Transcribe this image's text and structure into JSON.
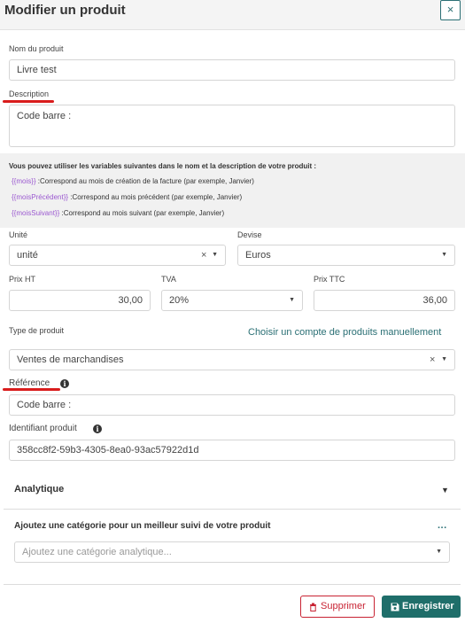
{
  "header": {
    "title": "Modifier un produit",
    "close": "×"
  },
  "fields": {
    "nom_label": "Nom du produit",
    "nom_value": "Livre test",
    "description_label": "Description",
    "description_value": "Code barre :",
    "unite_label": "Unité",
    "unite_value": "unité",
    "devise_label": "Devise",
    "devise_value": "Euros",
    "prix_ht_label": "Prix HT",
    "prix_ht_value": "30,00",
    "tva_label": "TVA",
    "tva_value": "20%",
    "prix_ttc_label": "Prix TTC",
    "prix_ttc_value": "36,00",
    "type_label": "Type de produit",
    "type_link": "Choisir un compte de produits manuellement",
    "type_value": "Ventes de marchandises",
    "reference_label": "Référence",
    "reference_value": "Code barre :",
    "identifiant_label": "Identifiant produit",
    "identifiant_value": "358cc8f2-59b3-4305-8ea0-93ac57922d1d"
  },
  "variables": {
    "title": "Vous pouvez utiliser les variables suivantes dans le nom et la description de votre produit :",
    "items": [
      {
        "token": "{{mois}}",
        "desc": " :Correspond au mois de création de la facture (par exemple, Janvier)"
      },
      {
        "token": "{{moisPrécédent}}",
        "desc": " :Correspond au mois précédent (par exemple, Janvier)"
      },
      {
        "token": "{{moisSuivant}}",
        "desc": " :Correspond au mois suivant (par exemple, Janvier)"
      }
    ]
  },
  "analytique": {
    "title": "Analytique",
    "category_title": "Ajoutez une catégorie pour un meilleur suivi de votre produit",
    "dots": "...",
    "placeholder": "Ajoutez une catégorie analytique..."
  },
  "actions": {
    "delete": "Supprimer",
    "save": "Enregistrer"
  },
  "icons": {
    "close": "close-icon",
    "info": "info-icon",
    "chevron": "chevron-down-icon",
    "trash": "trash-icon",
    "save": "floppy-disk-icon"
  },
  "colors": {
    "accent": "#2a6f74",
    "danger": "#c82333",
    "save_bg": "#1f6e6a",
    "token": "#9b59d0",
    "annotation": "#d91c1c"
  }
}
